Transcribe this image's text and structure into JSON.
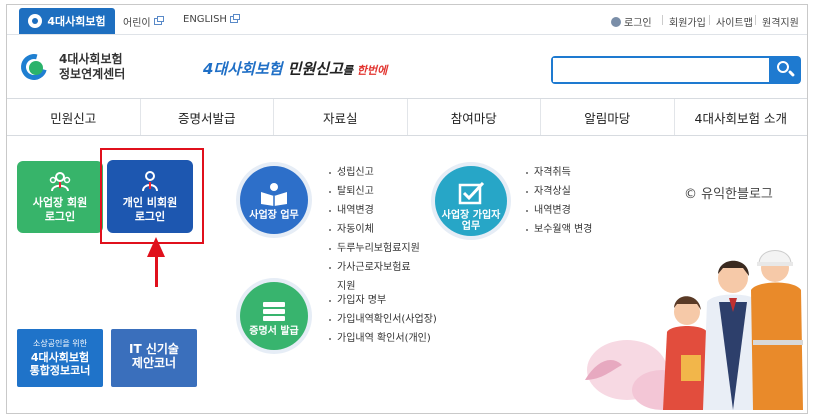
{
  "topbar": {
    "logo_tab": "4대사회보험",
    "links": [
      "어린이",
      "ENGLISH"
    ],
    "utils": [
      "로그인",
      "회원가입",
      "사이트맵",
      "원격지원"
    ]
  },
  "header": {
    "brand_line1": "4대사회보험",
    "brand_line2": "정보연계센터",
    "slogan_blue": "4대사회보험",
    "slogan_black": " 민원신고",
    "slogan_small": "를 ",
    "slogan_red": "한번에",
    "search_placeholder": ""
  },
  "gnb": [
    "민원신고",
    "증명서발급",
    "자료실",
    "참여마당",
    "알림마당",
    "4대사회보험 소개"
  ],
  "quick": {
    "biz_login": [
      "사업장 회원",
      "로그인"
    ],
    "person_login": [
      "개인 비회원",
      "로그인"
    ]
  },
  "banners": {
    "a_small": "소상공인을 위한",
    "a_big": [
      "4대사회보험",
      "통합정보코너"
    ],
    "b_big": [
      "IT 신기술",
      "제안코너"
    ]
  },
  "circles": {
    "biz": "사업장 업무",
    "join": [
      "사업장 가입자",
      "업무"
    ],
    "cert": "증명서 발급"
  },
  "lists": {
    "biz": [
      "성립신고",
      "탈퇴신고",
      "내역변경",
      "자동이체",
      "두루누리보험료지원",
      "가사근로자보험료"
    ],
    "biz_wrap": "지원",
    "join": [
      "자격취득",
      "자격상실",
      "내역변경",
      "보수월액 변경"
    ],
    "cert": [
      "가입자 명부",
      "가입내역확인서(사업장)",
      "가입내역 확인서(개인)"
    ]
  },
  "watermark": "© 유익한블로그",
  "colors": {
    "primary": "#1e7ad0",
    "green": "#37b46a",
    "navy": "#1d57b0",
    "highlight_red": "#e0101c"
  }
}
